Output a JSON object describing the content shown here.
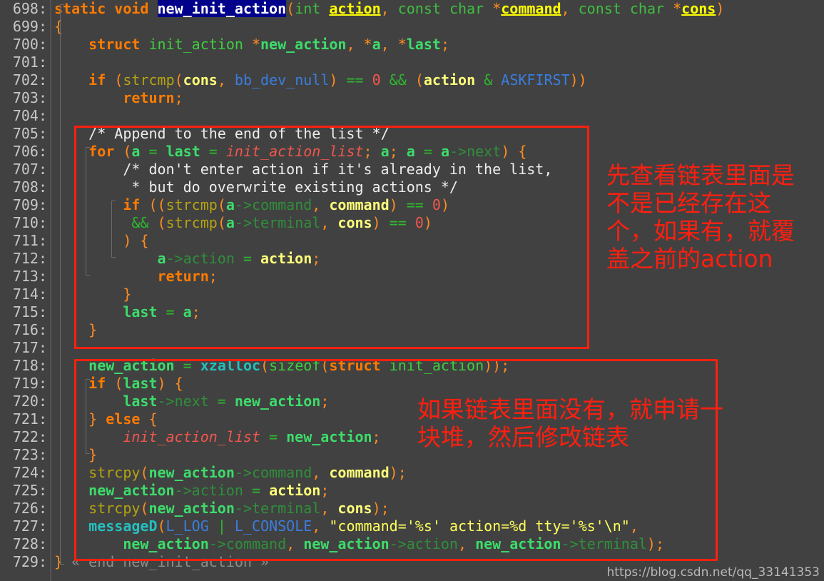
{
  "editor": {
    "background_color": "#414141",
    "gutter_color": "#414141",
    "default_text_color": "#d4d4d4",
    "font_size_px": 20,
    "line_height_px": 25,
    "first_line_number": 698,
    "last_line_number": 729
  },
  "gutter": {
    "line_numbers": [
      "698:",
      "699:",
      "700:",
      "701:",
      "702:",
      "703:",
      "704:",
      "705:",
      "706:",
      "707:",
      "708:",
      "709:",
      "710:",
      "711:",
      "712:",
      "713:",
      "714:",
      "715:",
      "716:",
      "717:",
      "718:",
      "719:",
      "720:",
      "721:",
      "722:",
      "723:",
      "724:",
      "725:",
      "726:",
      "727:",
      "728:",
      "729:"
    ]
  },
  "code": {
    "language": "C",
    "function_name": "new_init_action",
    "highlighted_symbol": "new_init_action",
    "highlight_bg_color": "#00008b",
    "highlight_fg_color": "#ffffff",
    "lines": [
      "static void new_init_action(int action, const char *command, const char *cons)",
      "{",
      "    struct init_action *new_action, *a, *last;",
      "",
      "    if (strcmp(cons, bb_dev_null) == 0 && (action & ASKFIRST))",
      "        return;",
      "",
      "    /* Append to the end of the list */",
      "    for (a = last = init_action_list; a; a = a->next) {",
      "        /* don't enter action if it's already in the list,",
      "         * but do overwrite existing actions */",
      "        if ((strcmp(a->command, command) == 0)",
      "         && (strcmp(a->terminal, cons) == 0)",
      "        ) {",
      "            a->action = action;",
      "            return;",
      "        }",
      "        last = a;",
      "    }",
      "",
      "    new_action = xzalloc(sizeof(struct init_action));",
      "    if (last) {",
      "        last->next = new_action;",
      "    } else {",
      "        init_action_list = new_action;",
      "    }",
      "    strcpy(new_action->command, command);",
      "    new_action->action = action;",
      "    strcpy(new_action->terminal, cons);",
      "    messageD(L_LOG | L_CONSOLE, \"command='%s' action=%d tty='%s'\\n\",",
      "        new_action->command, new_action->action, new_action->terminal);",
      "} « end new_init_action »"
    ],
    "fold_comment_line_729": "« end new_init_action »"
  },
  "annotations": {
    "color": "#ff1f0f",
    "boxes": [
      {
        "name": "list-search-block",
        "lines": "705-716"
      },
      {
        "name": "list-append-block",
        "lines": "718-728"
      }
    ],
    "note_1": "先查看链表里面是\n不是已经存在这\n个，如果有，就覆\n盖之前的action",
    "note_2": "如果链表里面没有，就申请一\n块堆，然后修改链表"
  },
  "watermark": {
    "text": "https://blog.csdn.net/qq_33141353"
  }
}
